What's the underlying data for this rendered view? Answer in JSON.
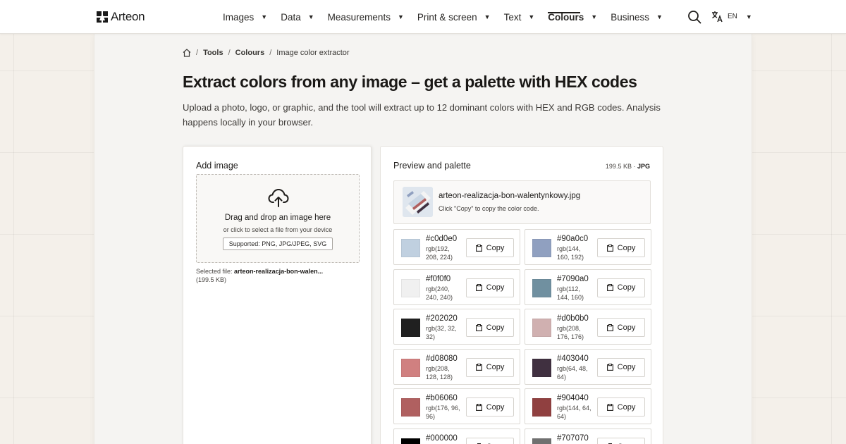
{
  "header": {
    "logo_text": "Arteon",
    "nav": [
      {
        "label": "Images",
        "active": false
      },
      {
        "label": "Data",
        "active": false
      },
      {
        "label": "Measurements",
        "active": false
      },
      {
        "label": "Print & screen",
        "active": false
      },
      {
        "label": "Text",
        "active": false
      },
      {
        "label": "Colours",
        "active": true
      },
      {
        "label": "Business",
        "active": false
      }
    ],
    "caret": "▼",
    "language": "EN"
  },
  "breadcrumb": {
    "items": [
      "Tools",
      "Colours"
    ],
    "current": "Image color extractor",
    "separator": "/"
  },
  "page": {
    "title": "Extract colors from any image – get a palette with HEX codes",
    "description": "Upload a photo, logo, or graphic, and the tool will extract up to 12 dominant colors with HEX and RGB codes. Analysis happens locally in your browser."
  },
  "upload_panel": {
    "title": "Add image",
    "dropzone_title": "Drag and drop an image here",
    "dropzone_subtitle": "or click to select a file from your device",
    "supported_formats": "Supported: PNG, JPG/JPEG, SVG",
    "selected_file_label": "Selected file:",
    "selected_file_name": "arteon-realizacja-bon-walen...",
    "selected_file_size": "(199.5 KB)"
  },
  "preview_panel": {
    "title": "Preview and palette",
    "file_size": "199.5 KB",
    "file_separator": "·",
    "file_type": "JPG",
    "file_name": "arteon-realizacja-bon-walentynkowy.jpg",
    "hint": "Click \"Copy\" to copy the color code.",
    "copy_label": "Copy"
  },
  "palette": [
    {
      "hex": "#c0d0e0",
      "rgb": "rgb(192, 208, 224)"
    },
    {
      "hex": "#90a0c0",
      "rgb": "rgb(144, 160, 192)"
    },
    {
      "hex": "#f0f0f0",
      "rgb": "rgb(240, 240, 240)"
    },
    {
      "hex": "#7090a0",
      "rgb": "rgb(112, 144, 160)"
    },
    {
      "hex": "#202020",
      "rgb": "rgb(32, 32, 32)"
    },
    {
      "hex": "#d0b0b0",
      "rgb": "rgb(208, 176, 176)"
    },
    {
      "hex": "#d08080",
      "rgb": "rgb(208, 128, 128)"
    },
    {
      "hex": "#403040",
      "rgb": "rgb(64, 48, 64)"
    },
    {
      "hex": "#b06060",
      "rgb": "rgb(176, 96, 96)"
    },
    {
      "hex": "#904040",
      "rgb": "rgb(144, 64, 64)"
    },
    {
      "hex": "#000000",
      "rgb": ""
    },
    {
      "hex": "#707070",
      "rgb": ""
    }
  ]
}
